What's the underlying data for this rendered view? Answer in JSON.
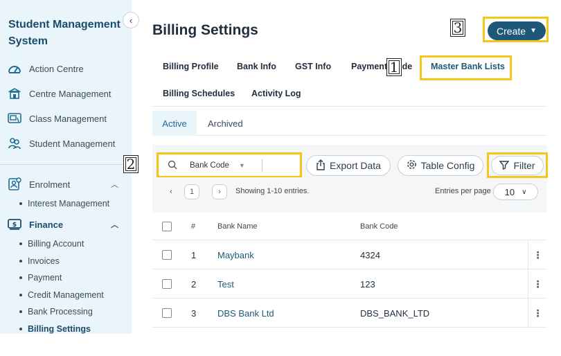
{
  "sidebar": {
    "title": "Student Management System",
    "collapse_icon": "chevron-left-icon",
    "nav": [
      {
        "label": "Action Centre",
        "icon": "gauge-icon"
      },
      {
        "label": "Centre Management",
        "icon": "building-icon"
      },
      {
        "label": "Class Management",
        "icon": "whiteboard-icon"
      },
      {
        "label": "Student Management",
        "icon": "students-icon"
      },
      {
        "label": "Enrolment",
        "icon": "enrolment-icon"
      },
      {
        "label": "Finance",
        "icon": "dollar-card-icon"
      }
    ],
    "enrolment_sub": [
      "Interest Management"
    ],
    "finance_sub": [
      "Billing Account",
      "Invoices",
      "Payment",
      "Credit Management",
      "Bank Processing",
      "Billing Settings"
    ]
  },
  "header": {
    "title": "Billing Settings",
    "create_label": "Create"
  },
  "tabs": [
    "Billing Profile",
    "Bank Info",
    "GST Info",
    "Payment Mode",
    "Master Bank Lists",
    "Billing Schedules",
    "Activity Log"
  ],
  "segments": {
    "active": "Active",
    "archived": "Archived"
  },
  "toolbar": {
    "search_field": "Bank Code",
    "export_label": "Export Data",
    "table_config_label": "Table Config",
    "filter_label": "Filter"
  },
  "pager": {
    "page": "1",
    "info": "Showing 1-10 entries.",
    "epp_label": "Entries per page",
    "epp_value": "10"
  },
  "table": {
    "headers": [
      "#",
      "Bank Name",
      "Bank Code"
    ],
    "rows": [
      {
        "num": "1",
        "name": "Maybank",
        "code": "4324"
      },
      {
        "num": "2",
        "name": "Test",
        "code": "123"
      },
      {
        "num": "3",
        "name": "DBS Bank Ltd",
        "code": "DBS_BANK_LTD"
      }
    ]
  },
  "annotations": [
    "1",
    "2",
    "3"
  ],
  "colors": {
    "highlight": "#f5c518",
    "primary": "#1e5878",
    "sidebar_bg": "#e9f4fb"
  }
}
